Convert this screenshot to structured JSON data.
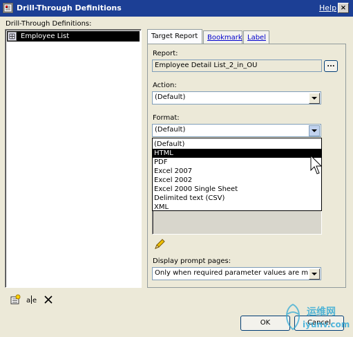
{
  "window": {
    "title": "Drill-Through Definitions",
    "help": "Help",
    "close_glyph": "×"
  },
  "left": {
    "label": "Drill-Through Definitions:",
    "items": [
      {
        "label": "Employee List",
        "icon": "report-grid-icon",
        "selected": true
      }
    ],
    "toolbar": [
      {
        "name": "new-definition-icon"
      },
      {
        "name": "rename-icon"
      },
      {
        "name": "delete-icon"
      }
    ]
  },
  "tabs": [
    {
      "label": "Target Report",
      "active": true
    },
    {
      "label": "Bookmark",
      "active": false
    },
    {
      "label": "Label",
      "active": false
    }
  ],
  "report": {
    "label": "Report:",
    "value": "Employee Detail List_2_in_OU",
    "browse_label": "..."
  },
  "action": {
    "label": "Action:",
    "value": "(Default)"
  },
  "format": {
    "label": "Format:",
    "value": "(Default)",
    "options": [
      "(Default)",
      "HTML",
      "PDF",
      "Excel 2007",
      "Excel 2002",
      "Excel 2000 Single Sheet",
      "Delimited text (CSV)",
      "XML"
    ],
    "highlighted": "HTML"
  },
  "display_prompt": {
    "label": "Display prompt pages:",
    "value": "Only when required parameter values are miss"
  },
  "buttons": {
    "ok": "OK",
    "cancel": "Cancel"
  },
  "watermark": {
    "text_cn": "运维网",
    "text_url": "iyunv.com"
  }
}
